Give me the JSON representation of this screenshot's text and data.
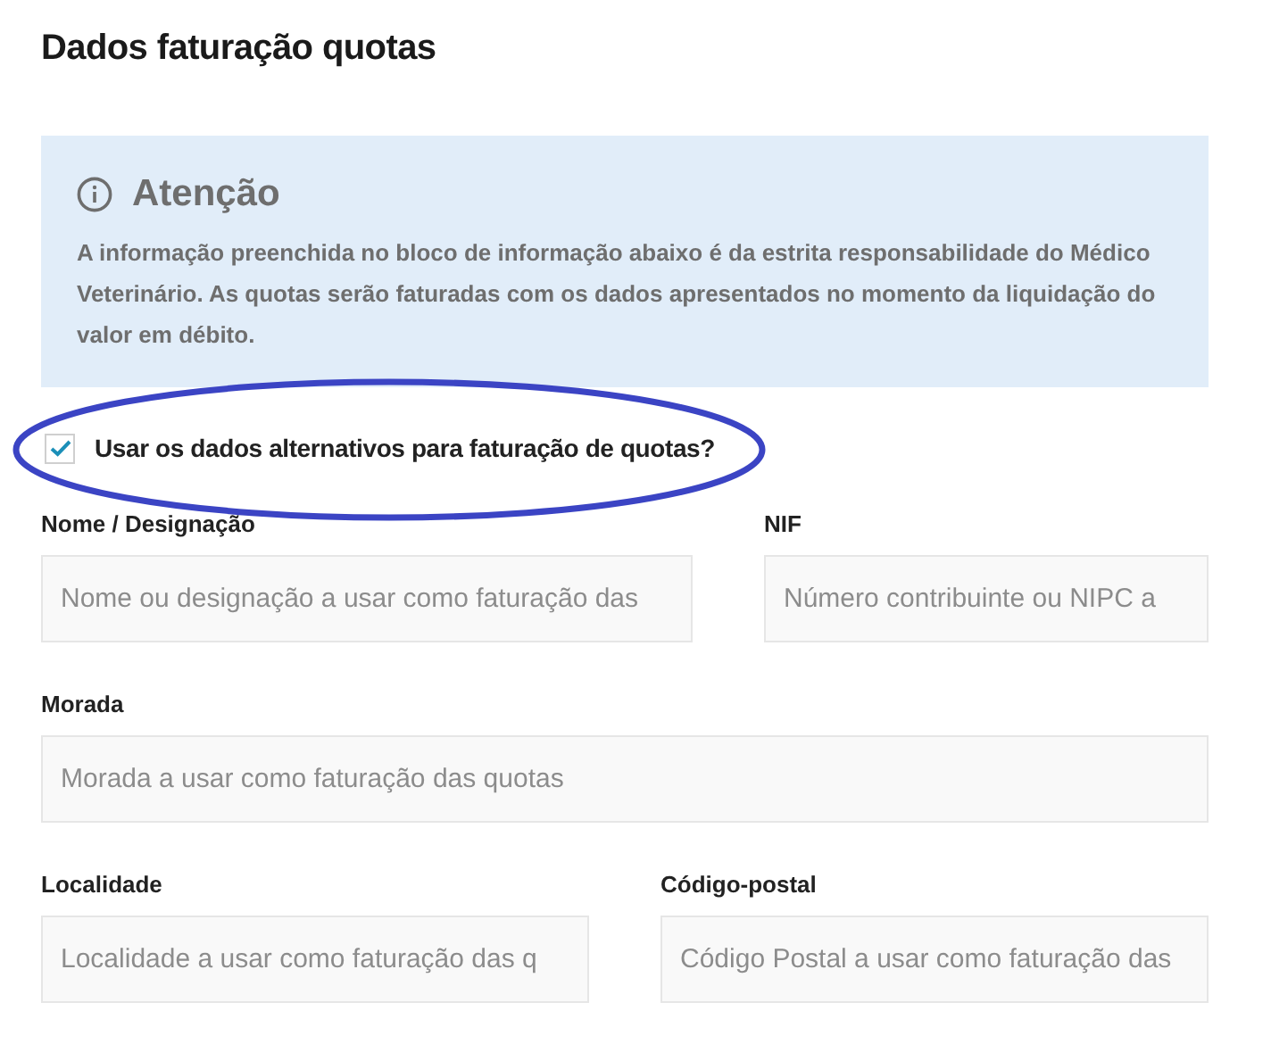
{
  "title": "Dados faturação quotas",
  "notice": {
    "title": "Atenção",
    "text": "A informação preenchida no bloco de informação abaixo é da estrita responsabilidade do Médico Veterinário. As quotas serão faturadas com os dados apresentados no momento da liquidação do valor em débito."
  },
  "alternative_data": {
    "label": "Usar os dados alternativos para faturação de quotas?",
    "checked": true
  },
  "field_rows": [
    [
      {
        "label": "Nome / Designação",
        "placeholder": "Nome ou designação a usar como faturação das"
      },
      {
        "label": "NIF",
        "placeholder": "Número contribuinte ou NIPC a"
      }
    ],
    [
      {
        "label": "Morada",
        "placeholder": "Morada a usar como faturação das quotas"
      }
    ],
    [
      {
        "label": "Localidade",
        "placeholder": "Localidade a usar como faturação das q"
      },
      {
        "label": "Código-postal",
        "placeholder": "Código Postal a usar como faturação das"
      }
    ]
  ]
}
